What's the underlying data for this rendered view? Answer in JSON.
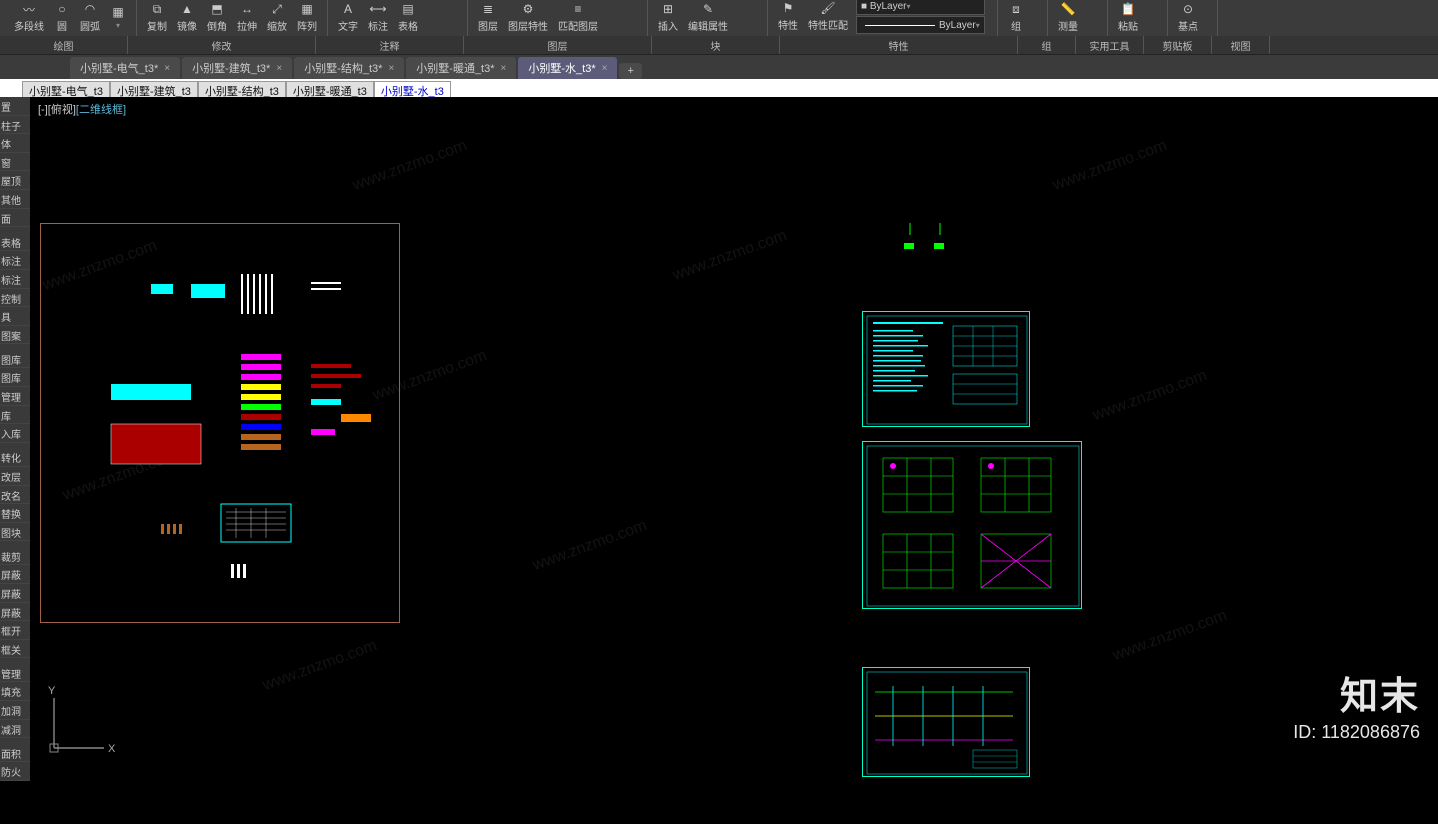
{
  "ribbon": {
    "row1": {
      "polyline": "多段线",
      "circle": "圆",
      "arc": "圆弧",
      "copy": "复制",
      "mirror": "镜像",
      "chamfer": "倒角",
      "stretch": "拉伸",
      "scale": "缩放",
      "array": "阵列",
      "text": "文字",
      "dimension": "标注",
      "table": "表格",
      "layer": "图层",
      "layer_props": "图层特性",
      "match_layer": "匹配图层",
      "insert": "插入",
      "edit_attr": "编辑属性",
      "properties": "特性",
      "match_props": "特性匹配",
      "by_layer": "ByLayer",
      "group": "组",
      "measure": "测量",
      "paste": "粘贴",
      "base": "基点"
    },
    "panels": {
      "draw": "绘图",
      "modify": "修改",
      "annotate": "注释",
      "layers": "图层",
      "block": "块",
      "props": "特性",
      "groups": "组",
      "util": "实用工具",
      "clipboard": "剪贴板",
      "view": "视图"
    }
  },
  "fileTabs": [
    {
      "label": "小别墅-电气_t3*"
    },
    {
      "label": "小别墅-建筑_t3*"
    },
    {
      "label": "小别墅-结构_t3*"
    },
    {
      "label": "小别墅-暖通_t3*"
    },
    {
      "label": "小别墅-水_t3*",
      "active": true
    }
  ],
  "layoutTabs": [
    {
      "label": "小别墅-电气_t3"
    },
    {
      "label": "小别墅-建筑_t3"
    },
    {
      "label": "小别墅-结构_t3"
    },
    {
      "label": "小别墅-暖通_t3"
    },
    {
      "label": "小别墅-水_t3",
      "active": true
    }
  ],
  "viewLabel": {
    "prefix": "[-][俯视]",
    "mode": "[二维线框]"
  },
  "sideTools": [
    "置",
    "柱子",
    "体",
    "窗",
    "屋顶",
    "其他",
    "面",
    "",
    "表格",
    "标注",
    "标注",
    "控制",
    "具",
    "图案",
    "",
    "图库",
    "图库",
    "管理",
    "库",
    "入库",
    "",
    "转化",
    "改层",
    "改名",
    "替换",
    "图块",
    "",
    "裁剪",
    "屏蔽",
    "屏蔽",
    "屏蔽",
    "框开",
    "框关",
    "",
    "管理",
    "填充",
    "加洞",
    "减洞",
    "",
    "面积",
    "防火"
  ],
  "ucs": {
    "x": "X",
    "y": "Y"
  },
  "brand": {
    "name": "知末",
    "id_label": "ID: ",
    "id_value": "1182086876"
  },
  "watermark_text": "www.znzmo.com"
}
